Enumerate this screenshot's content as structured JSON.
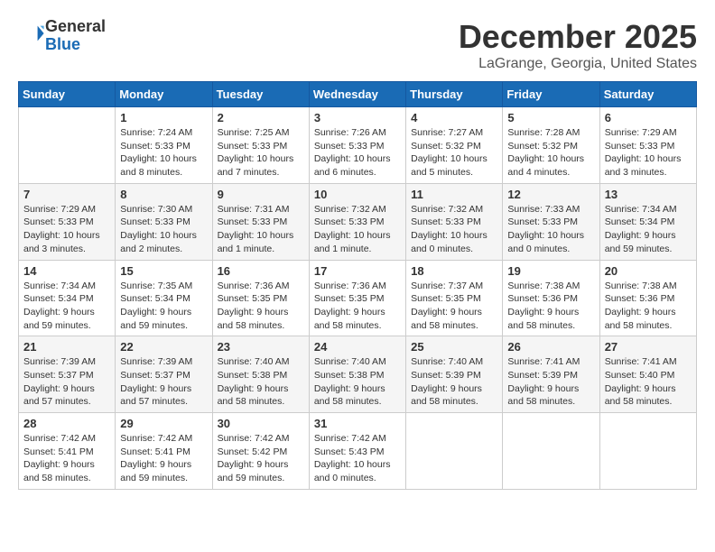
{
  "header": {
    "logo_line1": "General",
    "logo_line2": "Blue",
    "month": "December 2025",
    "location": "LaGrange, Georgia, United States"
  },
  "days_of_week": [
    "Sunday",
    "Monday",
    "Tuesday",
    "Wednesday",
    "Thursday",
    "Friday",
    "Saturday"
  ],
  "weeks": [
    [
      {
        "num": "",
        "info": ""
      },
      {
        "num": "1",
        "info": "Sunrise: 7:24 AM\nSunset: 5:33 PM\nDaylight: 10 hours\nand 8 minutes."
      },
      {
        "num": "2",
        "info": "Sunrise: 7:25 AM\nSunset: 5:33 PM\nDaylight: 10 hours\nand 7 minutes."
      },
      {
        "num": "3",
        "info": "Sunrise: 7:26 AM\nSunset: 5:33 PM\nDaylight: 10 hours\nand 6 minutes."
      },
      {
        "num": "4",
        "info": "Sunrise: 7:27 AM\nSunset: 5:32 PM\nDaylight: 10 hours\nand 5 minutes."
      },
      {
        "num": "5",
        "info": "Sunrise: 7:28 AM\nSunset: 5:32 PM\nDaylight: 10 hours\nand 4 minutes."
      },
      {
        "num": "6",
        "info": "Sunrise: 7:29 AM\nSunset: 5:33 PM\nDaylight: 10 hours\nand 3 minutes."
      }
    ],
    [
      {
        "num": "7",
        "info": "Sunrise: 7:29 AM\nSunset: 5:33 PM\nDaylight: 10 hours\nand 3 minutes."
      },
      {
        "num": "8",
        "info": "Sunrise: 7:30 AM\nSunset: 5:33 PM\nDaylight: 10 hours\nand 2 minutes."
      },
      {
        "num": "9",
        "info": "Sunrise: 7:31 AM\nSunset: 5:33 PM\nDaylight: 10 hours\nand 1 minute."
      },
      {
        "num": "10",
        "info": "Sunrise: 7:32 AM\nSunset: 5:33 PM\nDaylight: 10 hours\nand 1 minute."
      },
      {
        "num": "11",
        "info": "Sunrise: 7:32 AM\nSunset: 5:33 PM\nDaylight: 10 hours\nand 0 minutes."
      },
      {
        "num": "12",
        "info": "Sunrise: 7:33 AM\nSunset: 5:33 PM\nDaylight: 10 hours\nand 0 minutes."
      },
      {
        "num": "13",
        "info": "Sunrise: 7:34 AM\nSunset: 5:34 PM\nDaylight: 9 hours\nand 59 minutes."
      }
    ],
    [
      {
        "num": "14",
        "info": "Sunrise: 7:34 AM\nSunset: 5:34 PM\nDaylight: 9 hours\nand 59 minutes."
      },
      {
        "num": "15",
        "info": "Sunrise: 7:35 AM\nSunset: 5:34 PM\nDaylight: 9 hours\nand 59 minutes."
      },
      {
        "num": "16",
        "info": "Sunrise: 7:36 AM\nSunset: 5:35 PM\nDaylight: 9 hours\nand 58 minutes."
      },
      {
        "num": "17",
        "info": "Sunrise: 7:36 AM\nSunset: 5:35 PM\nDaylight: 9 hours\nand 58 minutes."
      },
      {
        "num": "18",
        "info": "Sunrise: 7:37 AM\nSunset: 5:35 PM\nDaylight: 9 hours\nand 58 minutes."
      },
      {
        "num": "19",
        "info": "Sunrise: 7:38 AM\nSunset: 5:36 PM\nDaylight: 9 hours\nand 58 minutes."
      },
      {
        "num": "20",
        "info": "Sunrise: 7:38 AM\nSunset: 5:36 PM\nDaylight: 9 hours\nand 58 minutes."
      }
    ],
    [
      {
        "num": "21",
        "info": "Sunrise: 7:39 AM\nSunset: 5:37 PM\nDaylight: 9 hours\nand 57 minutes."
      },
      {
        "num": "22",
        "info": "Sunrise: 7:39 AM\nSunset: 5:37 PM\nDaylight: 9 hours\nand 57 minutes."
      },
      {
        "num": "23",
        "info": "Sunrise: 7:40 AM\nSunset: 5:38 PM\nDaylight: 9 hours\nand 58 minutes."
      },
      {
        "num": "24",
        "info": "Sunrise: 7:40 AM\nSunset: 5:38 PM\nDaylight: 9 hours\nand 58 minutes."
      },
      {
        "num": "25",
        "info": "Sunrise: 7:40 AM\nSunset: 5:39 PM\nDaylight: 9 hours\nand 58 minutes."
      },
      {
        "num": "26",
        "info": "Sunrise: 7:41 AM\nSunset: 5:39 PM\nDaylight: 9 hours\nand 58 minutes."
      },
      {
        "num": "27",
        "info": "Sunrise: 7:41 AM\nSunset: 5:40 PM\nDaylight: 9 hours\nand 58 minutes."
      }
    ],
    [
      {
        "num": "28",
        "info": "Sunrise: 7:42 AM\nSunset: 5:41 PM\nDaylight: 9 hours\nand 58 minutes."
      },
      {
        "num": "29",
        "info": "Sunrise: 7:42 AM\nSunset: 5:41 PM\nDaylight: 9 hours\nand 59 minutes."
      },
      {
        "num": "30",
        "info": "Sunrise: 7:42 AM\nSunset: 5:42 PM\nDaylight: 9 hours\nand 59 minutes."
      },
      {
        "num": "31",
        "info": "Sunrise: 7:42 AM\nSunset: 5:43 PM\nDaylight: 10 hours\nand 0 minutes."
      },
      {
        "num": "",
        "info": ""
      },
      {
        "num": "",
        "info": ""
      },
      {
        "num": "",
        "info": ""
      }
    ]
  ]
}
